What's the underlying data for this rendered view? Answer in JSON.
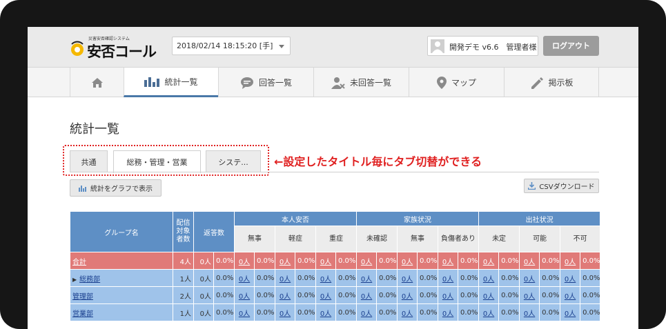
{
  "app": {
    "logo_small": "災害安否確認システム",
    "logo_big": "安否コール"
  },
  "header": {
    "date_select": "2018/02/14 18:15:20 [手]",
    "user": "開発デモ v6.6　管理者様",
    "logout": "ログアウト"
  },
  "nav": [
    {
      "label": "",
      "icon": "home-icon"
    },
    {
      "label": "統計一覧",
      "icon": "bar-chart-icon"
    },
    {
      "label": "回答一覧",
      "icon": "chat-icon"
    },
    {
      "label": "未回答一覧",
      "icon": "user-x-icon"
    },
    {
      "label": "マップ",
      "icon": "map-pin-icon"
    },
    {
      "label": "掲示板",
      "icon": "pencil-icon"
    }
  ],
  "page_title": "統計一覧",
  "tabs": [
    "共通",
    "総務・管理・営業",
    "システ..."
  ],
  "annotation": "←設定したタイトル毎にタブ切替ができる",
  "buttons": {
    "graph": "統計をグラフで表示",
    "csv": "CSVダウンロード"
  },
  "table": {
    "col_group": "グループ名",
    "col_target": "配信対象者数",
    "col_answers": "返答数",
    "sections": [
      {
        "title": "本人安否",
        "cols": [
          "無事",
          "軽症",
          "重症"
        ]
      },
      {
        "title": "家族状況",
        "cols": [
          "未確認",
          "無事",
          "負傷者あり"
        ]
      },
      {
        "title": "出社状況",
        "cols": [
          "未定",
          "可能",
          "不可"
        ]
      }
    ],
    "rows": [
      {
        "kind": "total",
        "name": "合計",
        "target": "4人",
        "answers": "0人",
        "answers_pct": "0.0%",
        "counts": [
          "0人",
          "0人",
          "0人",
          "0人",
          "0人",
          "0人",
          "0人",
          "0人",
          "0人"
        ],
        "pct": "0.0%"
      },
      {
        "kind": "dept",
        "name": "総務部",
        "expand": "▶",
        "target": "1人",
        "answers": "0人",
        "answers_pct": "0.0%",
        "counts": [
          "0人",
          "0人",
          "0人",
          "0人",
          "0人",
          "0人",
          "0人",
          "0人",
          "0人"
        ],
        "pct": "0.0%"
      },
      {
        "kind": "dept",
        "name": "管理部",
        "target": "2人",
        "answers": "0人",
        "answers_pct": "0.0%",
        "counts": [
          "0人",
          "0人",
          "0人",
          "0人",
          "0人",
          "0人",
          "0人",
          "0人",
          "0人"
        ],
        "pct": "0.0%"
      },
      {
        "kind": "dept",
        "name": "営業部",
        "target": "1人",
        "answers": "0人",
        "answers_pct": "0.0%",
        "counts": [
          "0人",
          "0人",
          "0人",
          "0人",
          "0人",
          "0人",
          "0人",
          "0人",
          "0人"
        ],
        "pct": "0.0%"
      }
    ]
  },
  "colors": {
    "header_blue": "#5e8fc5",
    "total_row": "#e07a78",
    "dept_row": "#9fc3ea",
    "annotation_red": "#e02020",
    "logo_yellow": "#f5b800"
  }
}
